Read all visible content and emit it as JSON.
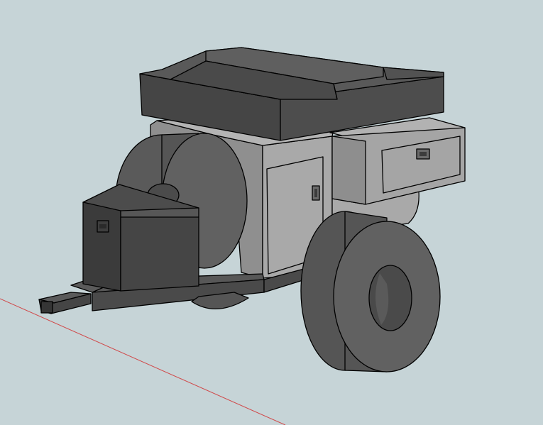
{
  "scene": {
    "background": "#c6d4d7",
    "axis_color": "#d0494a",
    "colors": {
      "body_light": "#a9a9a9",
      "body_mid": "#8f8f8f",
      "body_dark": "#6e6e6e",
      "dark": "#545454",
      "darker": "#444444",
      "darkest": "#2f2f2f",
      "tire_tread": "#555555",
      "tire_side": "#616161",
      "hub": "#4a4a4a"
    },
    "components": [
      "roof-cargo-box",
      "trailer-body",
      "side-storage-box",
      "spare-tire",
      "front-tongue-box",
      "trailer-frame",
      "tow-hitch",
      "wheel"
    ]
  }
}
